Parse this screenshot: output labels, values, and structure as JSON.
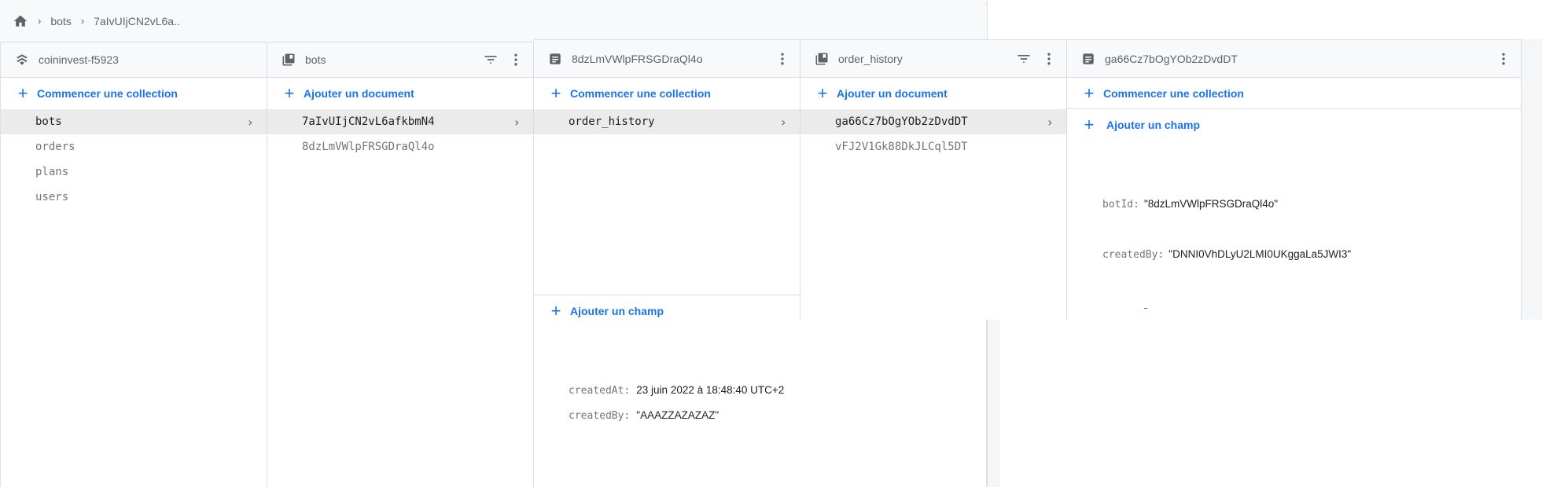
{
  "breadcrumb": {
    "home_icon": "home-icon",
    "items": [
      "bots",
      "7aIvUIjCN2vL6a.."
    ]
  },
  "columns": [
    {
      "title": "coininvest-f5923",
      "icon": "firestore-icon",
      "add_label": "Commencer une collection",
      "items": [
        {
          "label": "bots",
          "selected": true
        },
        {
          "label": "orders",
          "selected": false
        },
        {
          "label": "plans",
          "selected": false
        },
        {
          "label": "users",
          "selected": false
        }
      ]
    },
    {
      "title": "bots",
      "icon": "collection-icon",
      "add_label": "Ajouter un document",
      "items": [
        {
          "label": "7aIvUIjCN2vL6afkbmN4",
          "selected": true
        },
        {
          "label": "8dzLmVWlpFRSGDraQl4o",
          "selected": false
        }
      ]
    },
    {
      "title": "8dzLmVWlpFRSGDraQl4o",
      "icon": "document-icon",
      "add_label": "Commencer une collection",
      "items": [
        {
          "label": "order_history",
          "selected": true
        }
      ],
      "add_field_label": "Ajouter un champ",
      "fields": [
        {
          "key": "createdAt:",
          "value": "23 juin 2022 à 18:48:40 UTC+2"
        },
        {
          "key": "createdBy:",
          "value": "\"AAAZZAZAZAZ\""
        }
      ]
    },
    {
      "title": "order_history",
      "icon": "collection-icon",
      "add_label": "Ajouter un document",
      "items": [
        {
          "label": "ga66Cz7bOgYOb2zDvdDT",
          "selected": true
        },
        {
          "label": "vFJ2V1Gk88DkJLCql5DT",
          "selected": false
        }
      ]
    },
    {
      "title": "ga66Cz7bOgYOb2zDvdDT",
      "icon": "document-icon",
      "add_label": "Commencer une collection",
      "add_field_label": "Ajouter un champ",
      "fields": [
        {
          "key": "botId:",
          "value": "\"8dzLmVWlpFRSGDraQl4o\""
        },
        {
          "key": "createdBy:",
          "value": "\"DNNI0VhDLyU2LMI0UKggaLa5JWI3\""
        }
      ]
    }
  ],
  "colors": {
    "accent": "#1a73e8",
    "selected_row": "#ebebeb",
    "header_bg": "#f8f9fa",
    "border": "#dadce0"
  }
}
